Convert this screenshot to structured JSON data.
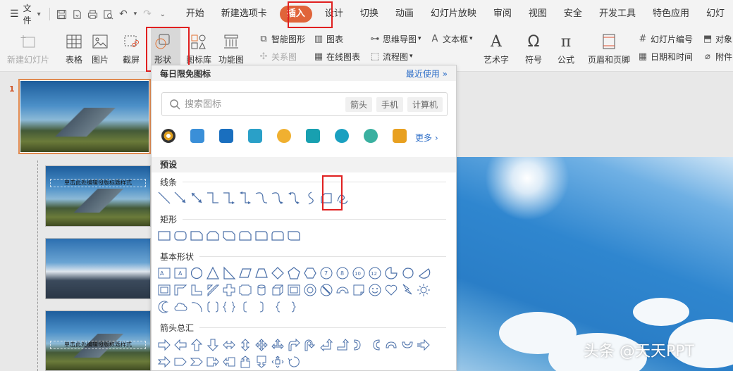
{
  "menubar": {
    "file_label": "文件",
    "tabs": [
      "开始",
      "新建选项卡",
      "插入",
      "设计",
      "切换",
      "动画",
      "幻灯片放映",
      "审阅",
      "视图",
      "安全",
      "开发工具",
      "特色应用",
      "幻灯"
    ],
    "active_tab": "插入"
  },
  "ribbon": {
    "new_slide": "新建幻灯片",
    "table": "表格",
    "picture": "图片",
    "screenshot": "截屏",
    "shape": "形状",
    "icon_lib": "图标库",
    "function_chart": "功能图",
    "smart_graphic": "智能图形",
    "relation_chart": "关系图",
    "chart": "图表",
    "online_chart": "在线图表",
    "mindmap": "思维导图",
    "flowchart": "流程图",
    "textbox": "文本框",
    "art_text": "艺术字",
    "symbol": "符号",
    "formula": "公式",
    "header_footer": "页眉和页脚",
    "slide_number": "幻灯片编号",
    "date_time": "日期和时间",
    "object": "对象",
    "attachment": "附件"
  },
  "thumbnails": {
    "slide_number": "1",
    "title_placeholder_1": "单击此处编辑母版标题样式",
    "title_placeholder_3": "单击此处编辑母版标题样式"
  },
  "panel": {
    "header_title": "每日限免图标",
    "recent": "最近使用",
    "search_placeholder": "搜索图标",
    "chips": [
      "箭头",
      "手机",
      "计算机"
    ],
    "more": "更多",
    "preset": "预设",
    "categories": {
      "lines": "线条",
      "rect": "矩形",
      "basic": "基本形状",
      "arrows": "箭头总汇"
    },
    "icon_colors": [
      "#e0a020",
      "#3a8fd8",
      "#1a6fbf",
      "#2aa0c8",
      "#f0b030",
      "#18a0b0",
      "#1aa0c0",
      "#3ab0a0",
      "#e8a020"
    ]
  },
  "watermark": "头条 @天天PPT"
}
